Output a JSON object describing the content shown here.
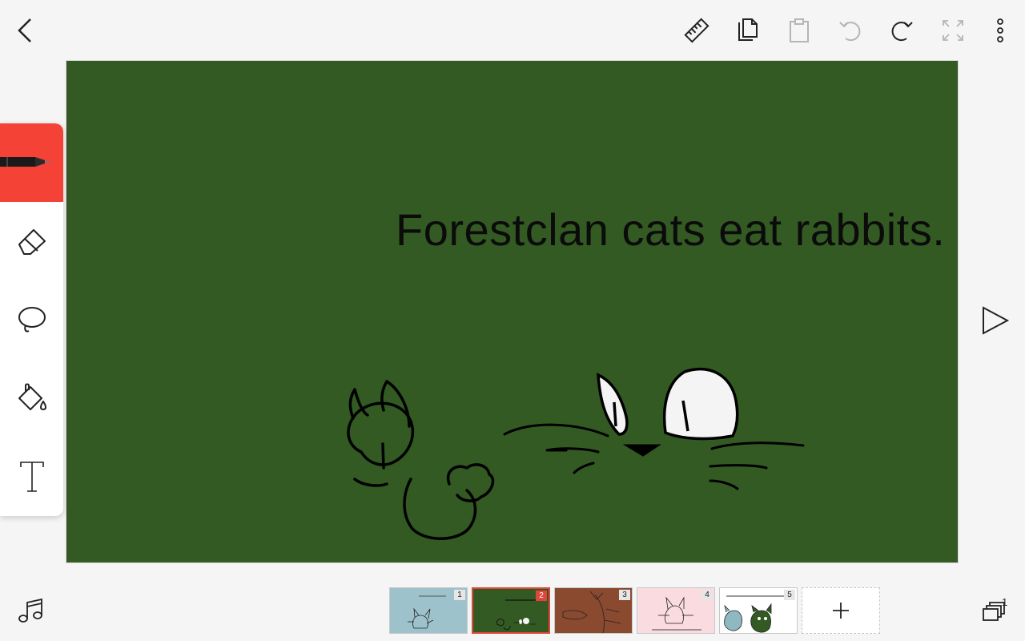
{
  "app": {
    "toolbar": {
      "back_icon": "chevron-left-icon",
      "ruler_icon": "ruler-icon",
      "copy_icon": "copy-icon",
      "paste_icon": "paste-icon",
      "undo_icon": "undo-icon",
      "redo_icon": "redo-icon",
      "fullscreen_icon": "fullscreen-icon",
      "more_icon": "more-vertical-icon"
    },
    "tools": [
      {
        "name": "pen",
        "icon": "pen-icon",
        "active": true
      },
      {
        "name": "eraser",
        "icon": "eraser-icon",
        "active": false
      },
      {
        "name": "lasso",
        "icon": "lasso-icon",
        "active": false
      },
      {
        "name": "fill",
        "icon": "paint-bucket-icon",
        "active": false
      },
      {
        "name": "text",
        "icon": "text-icon",
        "active": false
      }
    ],
    "accent_color": "#f44336"
  },
  "canvas": {
    "background_color": "#335a22",
    "caption": "Forestclan cats eat rabbits."
  },
  "frames": {
    "selected": 2,
    "count_badge": "1",
    "items": [
      {
        "number": "1",
        "background": "#9dc2cc"
      },
      {
        "number": "2",
        "background": "#335a22"
      },
      {
        "number": "3",
        "background": "#8a4a30"
      },
      {
        "number": "4",
        "background": "#fadbe0"
      },
      {
        "number": "5",
        "background": "#ffffff"
      }
    ],
    "add_icon": "plus-icon"
  },
  "bottom": {
    "music_icon": "music-note-icon",
    "frames_icon": "layers-icon",
    "play_icon": "play-icon"
  }
}
